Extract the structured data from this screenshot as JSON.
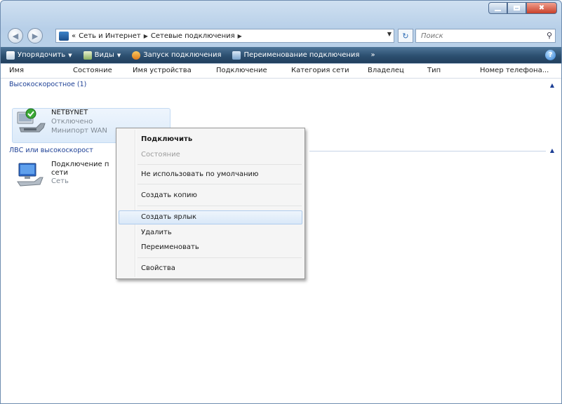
{
  "titlebar": {
    "minimize_icon": "minimize-icon",
    "maximize_icon": "maximize-icon",
    "close_icon": "close-icon",
    "close_glyph": "✖",
    "close_color": "#c8402a"
  },
  "address": {
    "back_glyph": "◀",
    "forward_glyph": "▶",
    "overflow": "«",
    "crumbs": [
      "Сеть и Интернет",
      "Сетевые подключения"
    ],
    "sep": "▶",
    "dropdown_glyph": "▼",
    "refresh_glyph": "↻",
    "search_placeholder": "Поиск",
    "search_glyph": "⚲"
  },
  "toolbar": {
    "organize": "Упорядочить",
    "views": "Виды",
    "start_connection": "Запуск подключения",
    "rename_connection": "Переименование подключения",
    "dropdown_glyph": "▼",
    "more_glyph": "»",
    "help_glyph": "?",
    "background": "#2c4f70"
  },
  "columns": [
    "Имя",
    "Состояние",
    "Имя устройства",
    "Подключение",
    "Категория сети",
    "Владелец",
    "Тип",
    "Номер телефона..."
  ],
  "groups": [
    {
      "header": "Высокоскоростное (1)",
      "collapse_glyph": "▲",
      "items": [
        {
          "name": "NETBYNET",
          "status": "Отключено",
          "device": "Минипорт WAN"
        }
      ]
    },
    {
      "header": "ЛВС или высокоскорост",
      "collapse_glyph": "▲",
      "items": [
        {
          "name_line1": "Подключение п",
          "name_line2": "сети",
          "status": "Сеть"
        }
      ]
    }
  ],
  "context_menu": {
    "items": [
      {
        "label": "Подключить",
        "bold": true
      },
      {
        "label": "Состояние",
        "disabled": true
      },
      {
        "label": "Не использовать по умолчанию"
      },
      {
        "label": "Создать копию"
      },
      {
        "label": "Создать ярлык",
        "highlighted": true
      },
      {
        "label": "Удалить"
      },
      {
        "label": "Переименовать"
      },
      {
        "label": "Свойства"
      }
    ],
    "highlight_color": "#d9e8f8"
  },
  "colors": {
    "group_header": "#1c3f95",
    "selection": "#dbeaf9",
    "status_ok": "#3aa935"
  }
}
